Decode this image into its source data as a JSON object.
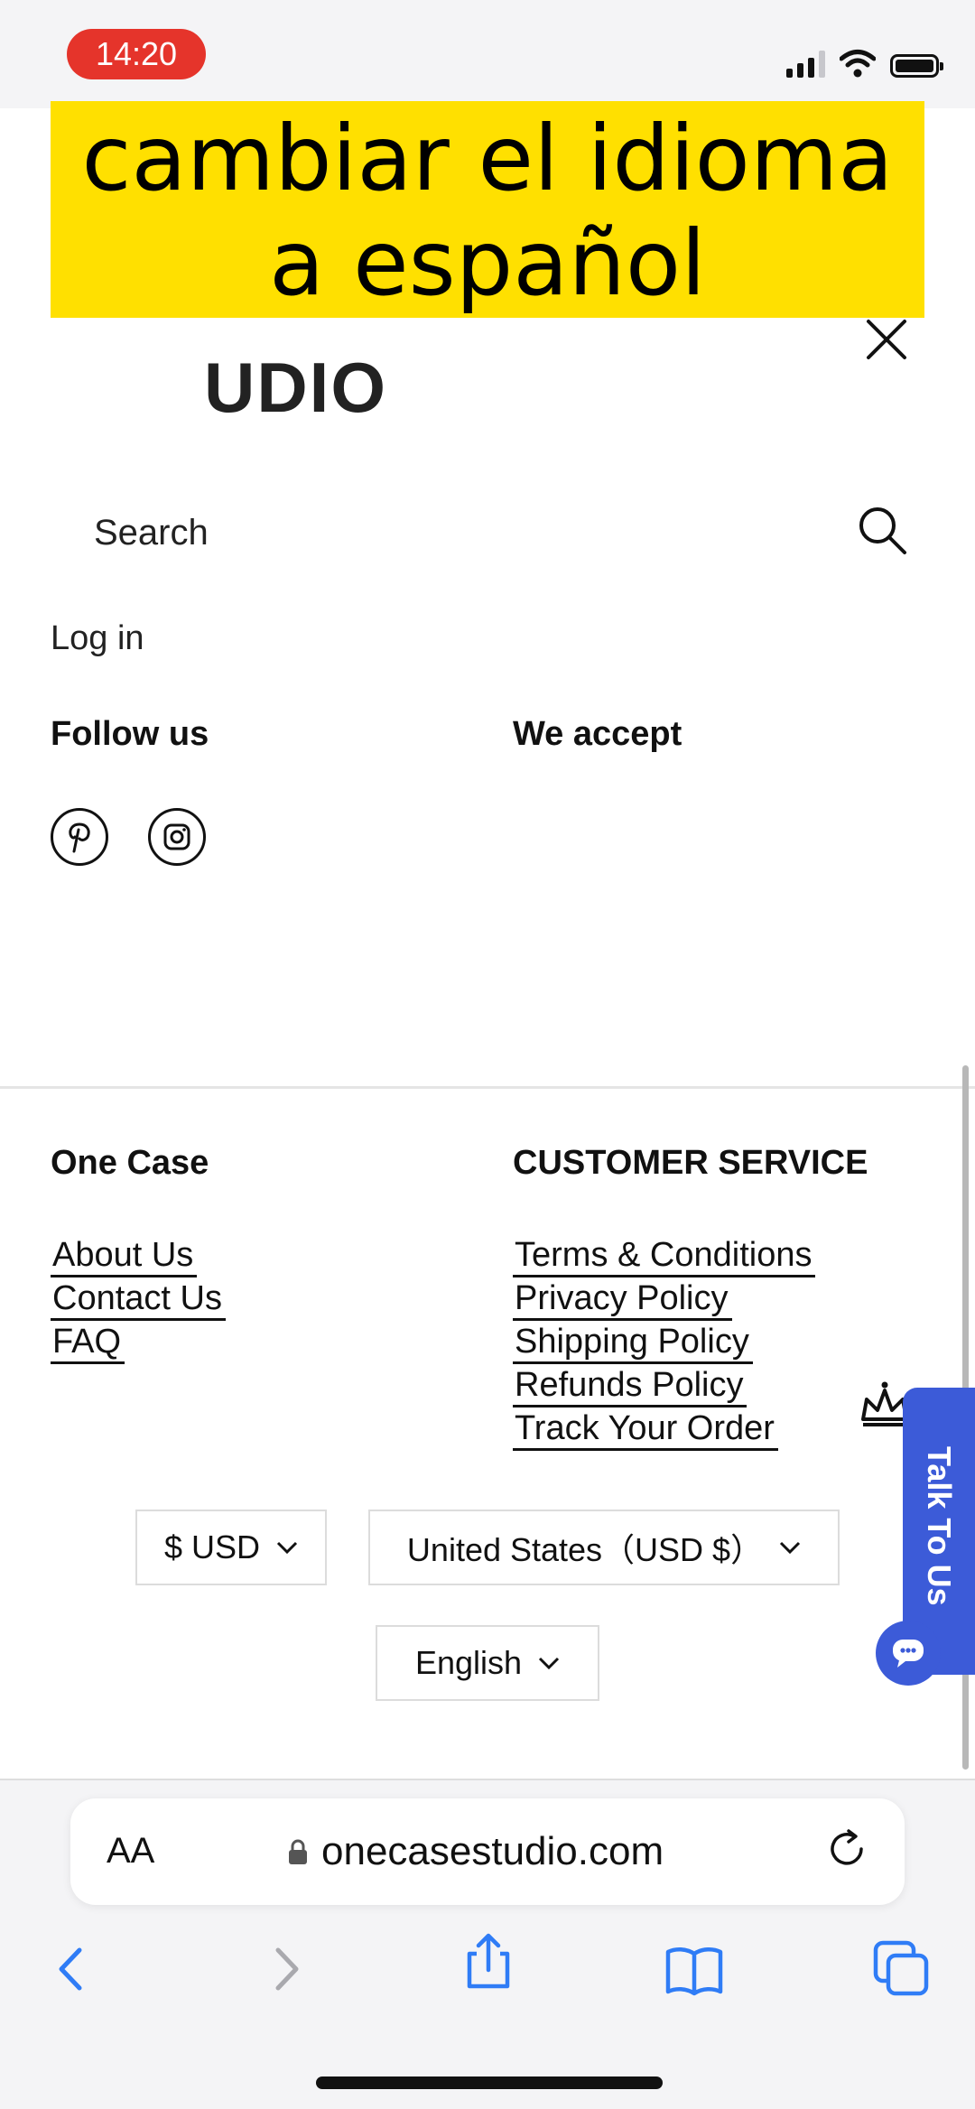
{
  "status_bar": {
    "time": "14:20"
  },
  "caption": {
    "line1": "cambiar el idioma",
    "line2": "a español"
  },
  "brand": {
    "logo_text": "UDIO"
  },
  "search": {
    "placeholder": "Search"
  },
  "account": {
    "login_label": "Log in"
  },
  "follow": {
    "heading": "Follow us",
    "icons": [
      "pinterest-icon",
      "instagram-icon"
    ]
  },
  "payments": {
    "heading": "We accept"
  },
  "footer": {
    "col1": {
      "heading": "One Case",
      "links": [
        "About Us",
        "Contact Us",
        "FAQ"
      ]
    },
    "col2": {
      "heading": "CUSTOMER SERVICE",
      "links": [
        "Terms & Conditions",
        "Privacy Policy",
        "Shipping Policy",
        "Refunds Policy",
        "Track Your Order"
      ]
    }
  },
  "selectors": {
    "currency": "$ USD",
    "country": "United States（USD $）",
    "language": "English"
  },
  "chat_widget": {
    "label": "Talk To Us"
  },
  "browser": {
    "aa_label": "AA",
    "url": "onecasestudio.com"
  },
  "colors": {
    "caption_bg": "#ffe000",
    "chat_blue": "#3c5bd8",
    "time_pill": "#e5342b",
    "ios_blue": "#2f7cf6"
  }
}
